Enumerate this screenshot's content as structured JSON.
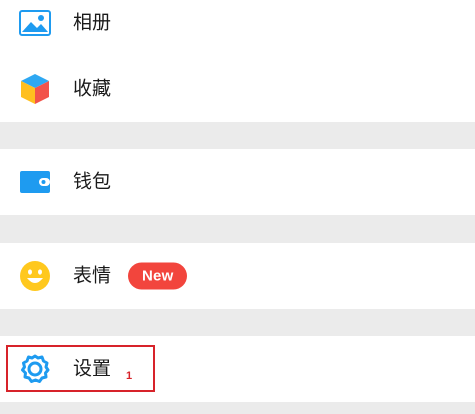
{
  "menu": {
    "group1": {
      "album_label": "相册",
      "favorites_label": "收藏"
    },
    "group2": {
      "wallet_label": "钱包"
    },
    "group3": {
      "stickers_label": "表情",
      "stickers_badge": "New"
    },
    "group4": {
      "settings_label": "设置"
    }
  },
  "annotation": {
    "number": "1"
  },
  "colors": {
    "background": "#ebebeb",
    "accent_blue": "#1e9bf0",
    "badge_red": "#f2453d",
    "highlight_red": "#d7232a",
    "emoji_yellow": "#ffc81e"
  },
  "icons": {
    "album": "image-icon",
    "favorites": "cube-icon",
    "wallet": "wallet-icon",
    "stickers": "smiley-icon",
    "settings": "gear-icon"
  }
}
